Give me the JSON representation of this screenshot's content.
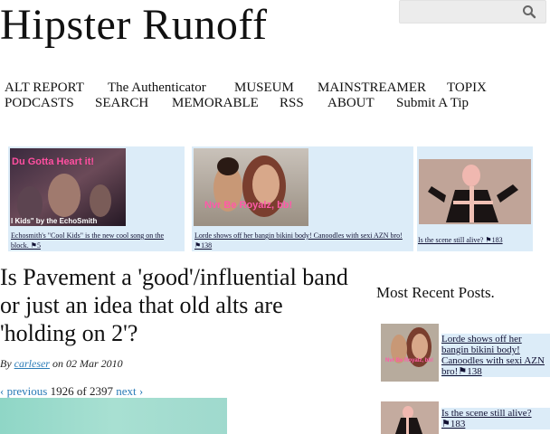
{
  "header": {
    "site_title": "Hipster Runoff",
    "search_placeholder": ""
  },
  "nav": {
    "row1": [
      "ALT REPORT",
      "The Authenticator",
      "MUSEUM",
      "MAINSTREAMER",
      "TOPIX"
    ],
    "row2": [
      "PODCASTS",
      "SEARCH",
      "MEMORABLE",
      "RSS",
      "ABOUT",
      "Submit A Tip"
    ]
  },
  "featured": [
    {
      "overlay": "Du Gotta Heart it!",
      "sub_overlay": "l Kids\" by the EchoSmith",
      "caption": "Echosmith's \"Cool Kids\" is the new cool song on the block. ⚑5"
    },
    {
      "overlay": "Nvr Be Royalz, bb!",
      "caption": "Lorde shows off her bangin bikini body! Canoodles with sexi AZN bro! ⚑138"
    },
    {
      "caption": "Is the scene still alive? ⚑183"
    }
  ],
  "post": {
    "title": "Is Pavement a 'good'/influential band or just an idea that old alts are 'holding on 2'?",
    "by": "By",
    "author": "carleser",
    "on": "on",
    "date": "02 Mar 2010",
    "prev": "‹ previous",
    "position": "1926 of 2397",
    "next": "next ›"
  },
  "sidebar": {
    "title": "Most Recent Posts.",
    "posts": [
      {
        "text": "Lorde shows off her bangin bikini body! Canoodles with sexi AZN bro!⚑138",
        "thumb_overlay": "Nvr Be Royalz, bb!"
      },
      {
        "text": "Is the scene still alive?⚑183"
      }
    ]
  },
  "colors": {
    "accent_link": "#2a7bb7",
    "caption_bg": "#dcecf8"
  }
}
